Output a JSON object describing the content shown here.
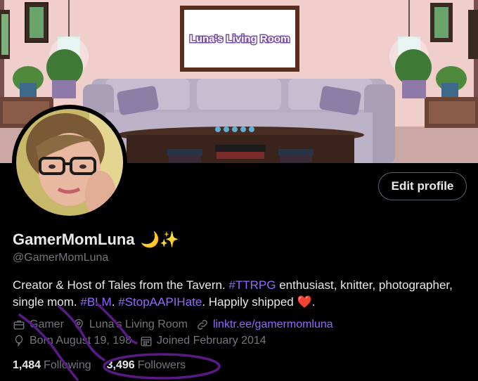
{
  "banner": {
    "sign_text": "Luna's Living Room"
  },
  "profile": {
    "display_name": "GamerMomLuna",
    "name_emoji": "🌙✨",
    "handle": "@GamerMomLuna",
    "edit_button": "Edit profile"
  },
  "bio": {
    "p1": "Creator & Host of Tales from the Tavern. ",
    "tag1": "#TTRPG",
    "p2": " enthusiast, knitter, photographer, single mom. ",
    "tag2": "#BLM",
    "p3": ". ",
    "tag3": "#StopAAPIHate",
    "p4": ". Happily shipped ",
    "heart": "❤️",
    "p5": "."
  },
  "meta": {
    "category": "Gamer",
    "location": "Luna's Living Room",
    "link": "linktr.ee/gamermomluna",
    "birthday": "Born August 19, 198",
    "joined": "Joined February 2014"
  },
  "stats": {
    "following_count": "1,484",
    "following_label": "Following",
    "followers_count": "3,496",
    "followers_label": "Followers"
  },
  "colors": {
    "accent": "#8f69ff",
    "annotation": "#5a1a86"
  }
}
